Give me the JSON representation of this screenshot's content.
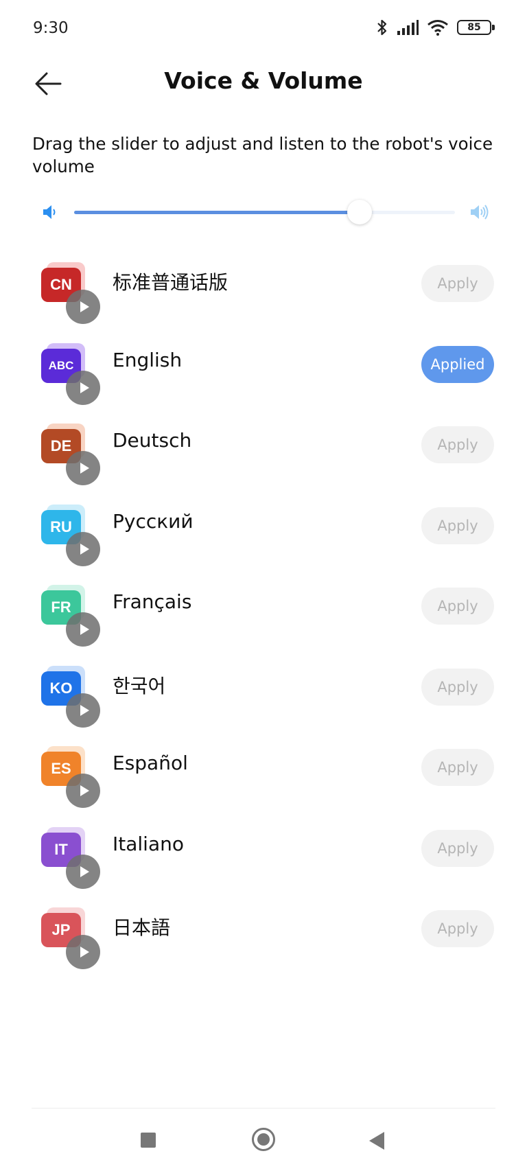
{
  "status_bar": {
    "time": "9:30",
    "battery": "85",
    "icons": [
      "bluetooth-icon",
      "signal-icon",
      "wifi-icon",
      "battery-icon"
    ]
  },
  "header": {
    "title": "Voice & Volume",
    "back_icon": "arrow-left-icon"
  },
  "description": "Drag the slider to adjust and listen to the robot's voice volume",
  "volume": {
    "level": 0.75,
    "low_icon": "speaker-low-icon",
    "high_icon": "speaker-high-icon"
  },
  "languages": [
    {
      "code": "CN",
      "name": "标准普通话版",
      "button": "Apply",
      "applied": false,
      "color": "#c62828",
      "back_color": "#f28a8a"
    },
    {
      "code": "ABC",
      "name": "English",
      "button": "Applied",
      "applied": true,
      "color": "#5b2bd8",
      "back_color": "#9b6cf0"
    },
    {
      "code": "DE",
      "name": "Deutsch",
      "button": "Apply",
      "applied": false,
      "color": "#b34a25",
      "back_color": "#f0a07a"
    },
    {
      "code": "RU",
      "name": "Русский",
      "button": "Apply",
      "applied": false,
      "color": "#2eb6ea",
      "back_color": "#8fd8f5"
    },
    {
      "code": "FR",
      "name": "Français",
      "button": "Apply",
      "applied": false,
      "color": "#3cc79b",
      "back_color": "#9be5cd"
    },
    {
      "code": "KO",
      "name": "한국어",
      "button": "Apply",
      "applied": false,
      "color": "#1f73e8",
      "back_color": "#8cb8f5"
    },
    {
      "code": "ES",
      "name": "Español",
      "button": "Apply",
      "applied": false,
      "color": "#f0832a",
      "back_color": "#f8bd87"
    },
    {
      "code": "IT",
      "name": "Italiano",
      "button": "Apply",
      "applied": false,
      "color": "#8a4fd0",
      "back_color": "#c09ce8"
    },
    {
      "code": "JP",
      "name": "日本語",
      "button": "Apply",
      "applied": false,
      "color": "#d9545a",
      "back_color": "#f0a3a6"
    }
  ],
  "nav": {
    "recent_icon": "square-recent-icon",
    "home_icon": "circle-home-icon",
    "back_icon": "triangle-back-icon"
  }
}
